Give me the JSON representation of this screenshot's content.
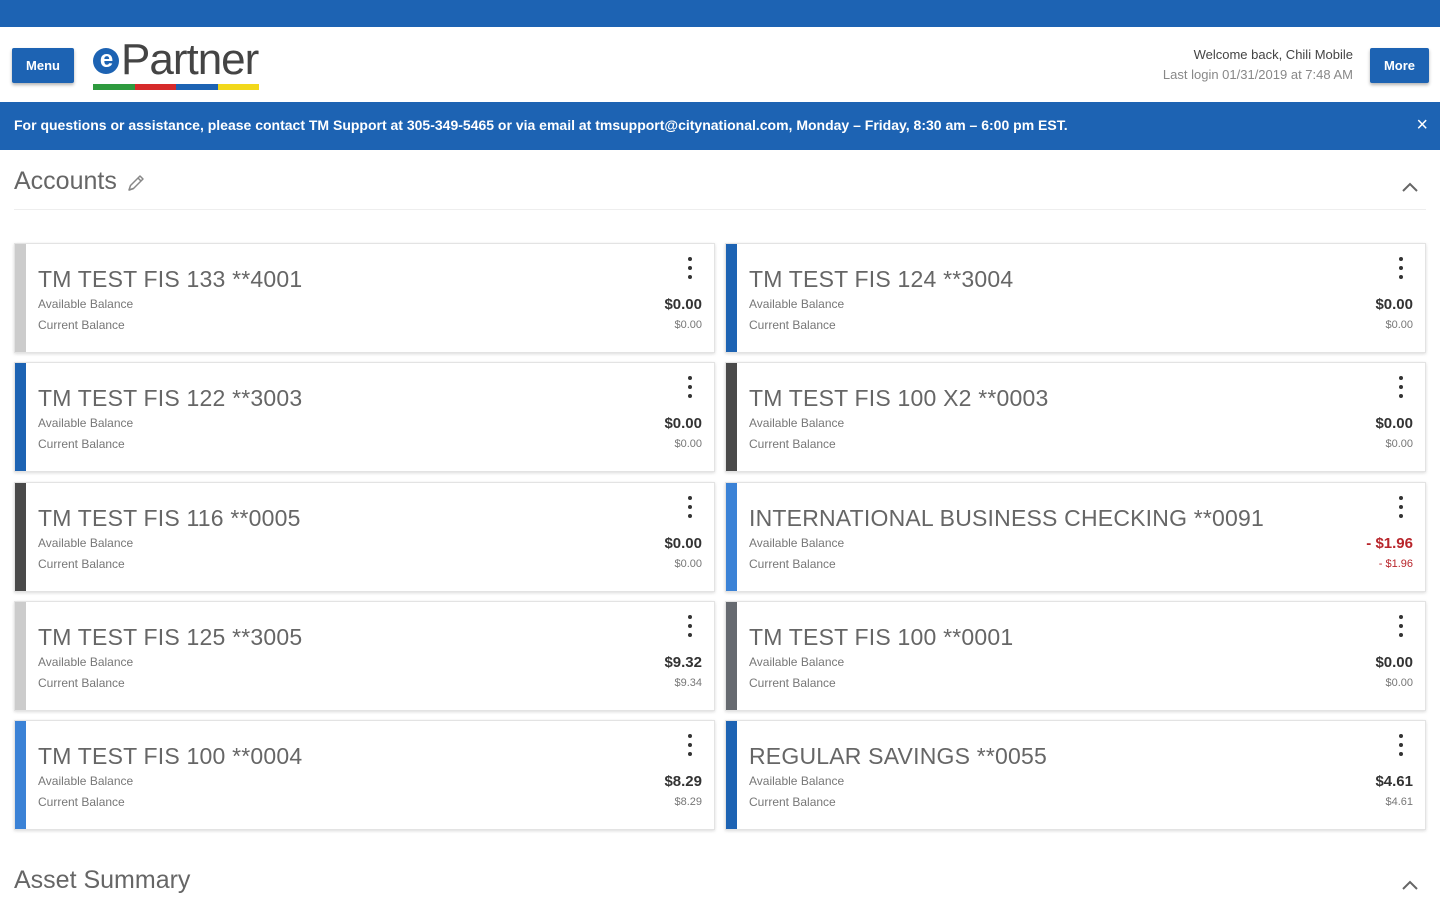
{
  "colors": {
    "brand": "#1d63b3",
    "accent_gray": "#cccccc",
    "accent_blue": "#1d63b3",
    "accent_light_blue": "#3b82d6",
    "accent_dark": "#4a4a4a",
    "accent_slate": "#666a70",
    "negative": "#b8252b",
    "logo_bar": [
      "#2e9a3e",
      "#d62a2a",
      "#1d63b3",
      "#f2d81a"
    ]
  },
  "header": {
    "menu_label": "Menu",
    "more_label": "More",
    "logo_e": "e",
    "logo_text": "Partner",
    "welcome": "Welcome back, Chili Mobile",
    "last_login": "Last login 01/31/2019 at 7:48 AM"
  },
  "banner": {
    "text": "For questions or assistance, please contact TM Support at 305-349-5465 or via email at tmsupport@citynational.com, Monday – Friday, 8:30 am – 6:00 pm EST.",
    "close": "×",
    "close_icon": "close-icon"
  },
  "accounts": {
    "title": "Accounts",
    "edit_icon": "pencil-icon",
    "collapse_icon": "chevron-up-icon",
    "available_label": "Available Balance",
    "current_label": "Current Balance",
    "cards": [
      {
        "name": "TM TEST FIS 133 **4001",
        "available": "$0.00",
        "current": "$0.00",
        "accent": "gray"
      },
      {
        "name": "TM TEST FIS 124 **3004",
        "available": "$0.00",
        "current": "$0.00",
        "accent": "blue"
      },
      {
        "name": "TM TEST FIS 122 **3003",
        "available": "$0.00",
        "current": "$0.00",
        "accent": "blue"
      },
      {
        "name": "TM TEST FIS 100 X2 **0003",
        "available": "$0.00",
        "current": "$0.00",
        "accent": "dark"
      },
      {
        "name": "TM TEST FIS 116 **0005",
        "available": "$0.00",
        "current": "$0.00",
        "accent": "dark"
      },
      {
        "name": "INTERNATIONAL BUSINESS CHECKING **0091",
        "available": "- $1.96",
        "current": "- $1.96",
        "accent": "light_blue",
        "negative": true
      },
      {
        "name": "TM TEST FIS 125 **3005",
        "available": "$9.32",
        "current": "$9.34",
        "accent": "gray"
      },
      {
        "name": "TM TEST FIS 100 **0001",
        "available": "$0.00",
        "current": "$0.00",
        "accent": "slate"
      },
      {
        "name": "TM TEST FIS 100 **0004",
        "available": "$8.29",
        "current": "$8.29",
        "accent": "light_blue"
      },
      {
        "name": "REGULAR SAVINGS **0055",
        "available": "$4.61",
        "current": "$4.61",
        "accent": "blue"
      }
    ]
  },
  "asset_summary": {
    "title": "Asset Summary",
    "collapse_icon": "chevron-up-icon"
  }
}
